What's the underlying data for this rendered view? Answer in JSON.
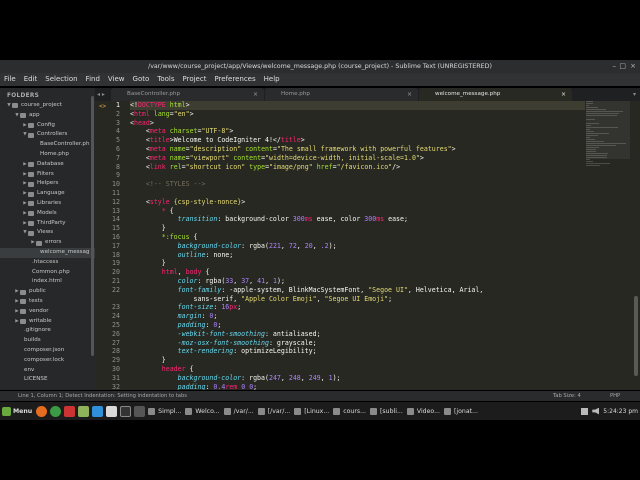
{
  "window": {
    "title": "/var/www/course_project/app/Views/welcome_message.php (course_project) - Sublime Text (UNREGISTERED)",
    "minimize": "–",
    "maximize": "□",
    "close": "×"
  },
  "menu": [
    "File",
    "Edit",
    "Selection",
    "Find",
    "View",
    "Goto",
    "Tools",
    "Project",
    "Preferences",
    "Help"
  ],
  "tabs": [
    {
      "label": "BaseController.php",
      "active": false
    },
    {
      "label": "Home.php",
      "active": false
    },
    {
      "label": "welcome_message.php",
      "active": true
    }
  ],
  "tab_nav": "◂ ▸",
  "tab_dropdown": "▾",
  "sidebar": {
    "heading": "FOLDERS",
    "items": [
      {
        "label": "course_project",
        "depth": 0,
        "type": "folder",
        "open": true
      },
      {
        "label": "app",
        "depth": 1,
        "type": "folder",
        "open": true
      },
      {
        "label": "Config",
        "depth": 2,
        "type": "folder",
        "open": false
      },
      {
        "label": "Controllers",
        "depth": 2,
        "type": "folder",
        "open": true
      },
      {
        "label": "BaseController.ph",
        "depth": 3,
        "type": "file"
      },
      {
        "label": "Home.php",
        "depth": 3,
        "type": "file"
      },
      {
        "label": "Database",
        "depth": 2,
        "type": "folder",
        "open": false
      },
      {
        "label": "Filters",
        "depth": 2,
        "type": "folder",
        "open": false
      },
      {
        "label": "Helpers",
        "depth": 2,
        "type": "folder",
        "open": false
      },
      {
        "label": "Language",
        "depth": 2,
        "type": "folder",
        "open": false
      },
      {
        "label": "Libraries",
        "depth": 2,
        "type": "folder",
        "open": false
      },
      {
        "label": "Models",
        "depth": 2,
        "type": "folder",
        "open": false
      },
      {
        "label": "ThirdParty",
        "depth": 2,
        "type": "folder",
        "open": false
      },
      {
        "label": "Views",
        "depth": 2,
        "type": "folder",
        "open": true
      },
      {
        "label": "errors",
        "depth": 3,
        "type": "folder",
        "open": false
      },
      {
        "label": "welcome_messag",
        "depth": 3,
        "type": "file",
        "selected": true
      },
      {
        "label": ".htaccess",
        "depth": 2,
        "type": "file"
      },
      {
        "label": "Common.php",
        "depth": 2,
        "type": "file"
      },
      {
        "label": "index.html",
        "depth": 2,
        "type": "file"
      },
      {
        "label": "public",
        "depth": 1,
        "type": "folder",
        "open": false
      },
      {
        "label": "tests",
        "depth": 1,
        "type": "folder",
        "open": false
      },
      {
        "label": "vendor",
        "depth": 1,
        "type": "folder",
        "open": false
      },
      {
        "label": "writable",
        "depth": 1,
        "type": "folder",
        "open": false
      },
      {
        "label": ".gitignore",
        "depth": 1,
        "type": "file"
      },
      {
        "label": "builds",
        "depth": 1,
        "type": "file"
      },
      {
        "label": "composer.json",
        "depth": 1,
        "type": "file"
      },
      {
        "label": "composer.lock",
        "depth": 1,
        "type": "file"
      },
      {
        "label": "env",
        "depth": 1,
        "type": "file"
      },
      {
        "label": "LICENSE",
        "depth": 1,
        "type": "file"
      }
    ]
  },
  "editor": {
    "fold_marker": "<>",
    "current_line": 1,
    "lines": [
      {
        "n": "1",
        "t": [
          [
            "plain",
            "<!"
          ],
          [
            "tag",
            "DOCTYPE"
          ],
          [
            "plain",
            " "
          ],
          [
            "attr",
            "html"
          ],
          [
            "plain",
            ">"
          ]
        ]
      },
      {
        "n": "2",
        "t": [
          [
            "plain",
            "<"
          ],
          [
            "tag",
            "html"
          ],
          [
            "plain",
            " "
          ],
          [
            "attr",
            "lang"
          ],
          [
            "plain",
            "="
          ],
          [
            "str",
            "\"en\""
          ],
          [
            "plain",
            ">"
          ]
        ]
      },
      {
        "n": "3",
        "t": [
          [
            "plain",
            "<"
          ],
          [
            "tag",
            "head"
          ],
          [
            "plain",
            ">"
          ]
        ]
      },
      {
        "n": "4",
        "t": [
          [
            "plain",
            "    <"
          ],
          [
            "tag",
            "meta"
          ],
          [
            "plain",
            " "
          ],
          [
            "attr",
            "charset"
          ],
          [
            "plain",
            "="
          ],
          [
            "str",
            "\"UTF-8\""
          ],
          [
            "plain",
            ">"
          ]
        ]
      },
      {
        "n": "5",
        "t": [
          [
            "plain",
            "    <"
          ],
          [
            "tag",
            "title"
          ],
          [
            "plain",
            ">Welcome to CodeIgniter 4!</"
          ],
          [
            "tag",
            "title"
          ],
          [
            "plain",
            ">"
          ]
        ]
      },
      {
        "n": "6",
        "t": [
          [
            "plain",
            "    <"
          ],
          [
            "tag",
            "meta"
          ],
          [
            "plain",
            " "
          ],
          [
            "attr",
            "name"
          ],
          [
            "plain",
            "="
          ],
          [
            "str",
            "\"description\""
          ],
          [
            "plain",
            " "
          ],
          [
            "attr",
            "content"
          ],
          [
            "plain",
            "="
          ],
          [
            "str",
            "\"The small framework with powerful features\""
          ],
          [
            "plain",
            ">"
          ]
        ]
      },
      {
        "n": "7",
        "t": [
          [
            "plain",
            "    <"
          ],
          [
            "tag",
            "meta"
          ],
          [
            "plain",
            " "
          ],
          [
            "attr",
            "name"
          ],
          [
            "plain",
            "="
          ],
          [
            "str",
            "\"viewport\""
          ],
          [
            "plain",
            " "
          ],
          [
            "attr",
            "content"
          ],
          [
            "plain",
            "="
          ],
          [
            "str",
            "\"width=device-width, initial-scale=1.0\""
          ],
          [
            "plain",
            ">"
          ]
        ]
      },
      {
        "n": "8",
        "t": [
          [
            "plain",
            "    <"
          ],
          [
            "tag",
            "link"
          ],
          [
            "plain",
            " "
          ],
          [
            "attr",
            "rel"
          ],
          [
            "plain",
            "="
          ],
          [
            "str",
            "\"shortcut icon\""
          ],
          [
            "plain",
            " "
          ],
          [
            "attr",
            "type"
          ],
          [
            "plain",
            "="
          ],
          [
            "str",
            "\"image/png\""
          ],
          [
            "plain",
            " "
          ],
          [
            "attr",
            "href"
          ],
          [
            "plain",
            "="
          ],
          [
            "str",
            "\"/favicon.ico\""
          ],
          [
            "plain",
            "/>"
          ]
        ]
      },
      {
        "n": "9",
        "t": []
      },
      {
        "n": "10",
        "t": [
          [
            "com",
            "    <!-- STYLES -->"
          ]
        ]
      },
      {
        "n": "11",
        "t": []
      },
      {
        "n": "12",
        "t": [
          [
            "plain",
            "    <"
          ],
          [
            "tag",
            "style"
          ],
          [
            "plain",
            " "
          ],
          [
            "str",
            "{csp-style-nonce}"
          ],
          [
            "plain",
            ">"
          ]
        ]
      },
      {
        "n": "13",
        "t": [
          [
            "plain",
            "        "
          ],
          [
            "tag",
            "*"
          ],
          [
            "plain",
            " {"
          ]
        ]
      },
      {
        "n": "14",
        "t": [
          [
            "plain",
            "            "
          ],
          [
            "prop",
            "transition"
          ],
          [
            "plain",
            ": background-color "
          ],
          [
            "num",
            "300"
          ],
          [
            "tag",
            "ms"
          ],
          [
            "plain",
            " ease, color "
          ],
          [
            "num",
            "300"
          ],
          [
            "tag",
            "ms"
          ],
          [
            "plain",
            " ease;"
          ]
        ]
      },
      {
        "n": "15",
        "t": [
          [
            "plain",
            "        }"
          ]
        ]
      },
      {
        "n": "16",
        "t": [
          [
            "plain",
            "        "
          ],
          [
            "sel",
            "*:focus"
          ],
          [
            "plain",
            " {"
          ]
        ]
      },
      {
        "n": "17",
        "t": [
          [
            "plain",
            "            "
          ],
          [
            "prop",
            "background-color"
          ],
          [
            "plain",
            ": rgba("
          ],
          [
            "num",
            "221"
          ],
          [
            "plain",
            ", "
          ],
          [
            "num",
            "72"
          ],
          [
            "plain",
            ", "
          ],
          [
            "num",
            "20"
          ],
          [
            "plain",
            ", "
          ],
          [
            "num",
            ".2"
          ],
          [
            "plain",
            ");"
          ]
        ]
      },
      {
        "n": "18",
        "t": [
          [
            "plain",
            "            "
          ],
          [
            "prop",
            "outline"
          ],
          [
            "plain",
            ": none;"
          ]
        ]
      },
      {
        "n": "19",
        "t": [
          [
            "plain",
            "        }"
          ]
        ]
      },
      {
        "n": "20",
        "t": [
          [
            "plain",
            "        "
          ],
          [
            "tag",
            "html"
          ],
          [
            "plain",
            ", "
          ],
          [
            "tag",
            "body"
          ],
          [
            "plain",
            " {"
          ]
        ]
      },
      {
        "n": "21",
        "t": [
          [
            "plain",
            "            "
          ],
          [
            "prop",
            "color"
          ],
          [
            "plain",
            ": rgba("
          ],
          [
            "num",
            "33"
          ],
          [
            "plain",
            ", "
          ],
          [
            "num",
            "37"
          ],
          [
            "plain",
            ", "
          ],
          [
            "num",
            "41"
          ],
          [
            "plain",
            ", "
          ],
          [
            "num",
            "1"
          ],
          [
            "plain",
            ");"
          ]
        ]
      },
      {
        "n": "22",
        "t": [
          [
            "plain",
            "            "
          ],
          [
            "prop",
            "font-family"
          ],
          [
            "plain",
            ": -apple-system, BlinkMacSystemFont, "
          ],
          [
            "str",
            "\"Segoe UI\""
          ],
          [
            "plain",
            ", Helvetica, Arial,"
          ]
        ]
      },
      {
        "n": "",
        "t": [
          [
            "plain",
            "                sans-serif, "
          ],
          [
            "str",
            "\"Apple Color Emoji\""
          ],
          [
            "plain",
            ", "
          ],
          [
            "str",
            "\"Segoe UI Emoji\""
          ],
          [
            "plain",
            ";"
          ]
        ]
      },
      {
        "n": "23",
        "t": [
          [
            "plain",
            "            "
          ],
          [
            "prop",
            "font-size"
          ],
          [
            "plain",
            ": "
          ],
          [
            "num",
            "16"
          ],
          [
            "tag",
            "px"
          ],
          [
            "plain",
            ";"
          ]
        ]
      },
      {
        "n": "24",
        "t": [
          [
            "plain",
            "            "
          ],
          [
            "prop",
            "margin"
          ],
          [
            "plain",
            ": "
          ],
          [
            "num",
            "0"
          ],
          [
            "plain",
            ";"
          ]
        ]
      },
      {
        "n": "25",
        "t": [
          [
            "plain",
            "            "
          ],
          [
            "prop",
            "padding"
          ],
          [
            "plain",
            ": "
          ],
          [
            "num",
            "0"
          ],
          [
            "plain",
            ";"
          ]
        ]
      },
      {
        "n": "26",
        "t": [
          [
            "plain",
            "            "
          ],
          [
            "prop",
            "-webkit-font-smoothing"
          ],
          [
            "plain",
            ": antialiased;"
          ]
        ]
      },
      {
        "n": "27",
        "t": [
          [
            "plain",
            "            "
          ],
          [
            "prop",
            "-moz-osx-font-smoothing"
          ],
          [
            "plain",
            ": grayscale;"
          ]
        ]
      },
      {
        "n": "28",
        "t": [
          [
            "plain",
            "            "
          ],
          [
            "prop",
            "text-rendering"
          ],
          [
            "plain",
            ": optimizeLegibility;"
          ]
        ]
      },
      {
        "n": "29",
        "t": [
          [
            "plain",
            "        }"
          ]
        ]
      },
      {
        "n": "30",
        "t": [
          [
            "plain",
            "        "
          ],
          [
            "tag",
            "header"
          ],
          [
            "plain",
            " {"
          ]
        ]
      },
      {
        "n": "31",
        "t": [
          [
            "plain",
            "            "
          ],
          [
            "prop",
            "background-color"
          ],
          [
            "plain",
            ": rgba("
          ],
          [
            "num",
            "247"
          ],
          [
            "plain",
            ", "
          ],
          [
            "num",
            "248"
          ],
          [
            "plain",
            ", "
          ],
          [
            "num",
            "249"
          ],
          [
            "plain",
            ", "
          ],
          [
            "num",
            "1"
          ],
          [
            "plain",
            ");"
          ]
        ]
      },
      {
        "n": "32",
        "t": [
          [
            "plain",
            "            "
          ],
          [
            "prop",
            "padding"
          ],
          [
            "plain",
            ": "
          ],
          [
            "num",
            "0.4"
          ],
          [
            "tag",
            "rem"
          ],
          [
            "plain",
            " "
          ],
          [
            "num",
            "0"
          ],
          [
            "plain",
            " "
          ],
          [
            "num",
            "0"
          ],
          [
            "plain",
            ";"
          ]
        ]
      }
    ]
  },
  "statusbar": {
    "left": "Line 1, Column 1; Detect Indentation: Setting indentation to tabs",
    "tab_size": "Tab Size: 4",
    "syntax": "PHP"
  },
  "taskbar": {
    "menu_label": "Menu",
    "tasks": [
      "Simpl...",
      "Welco...",
      "/var/...",
      "[/var/...",
      "[Linux...",
      "cours...",
      "[subli...",
      "Video...",
      "[jonat..."
    ],
    "clock": "5:24:23 pm",
    "task_color": "#8a8a8a"
  },
  "colors": {
    "editor_bg": "#272822",
    "sidebar_bg": "#262829",
    "folder_icon": "#8c8c8c"
  }
}
